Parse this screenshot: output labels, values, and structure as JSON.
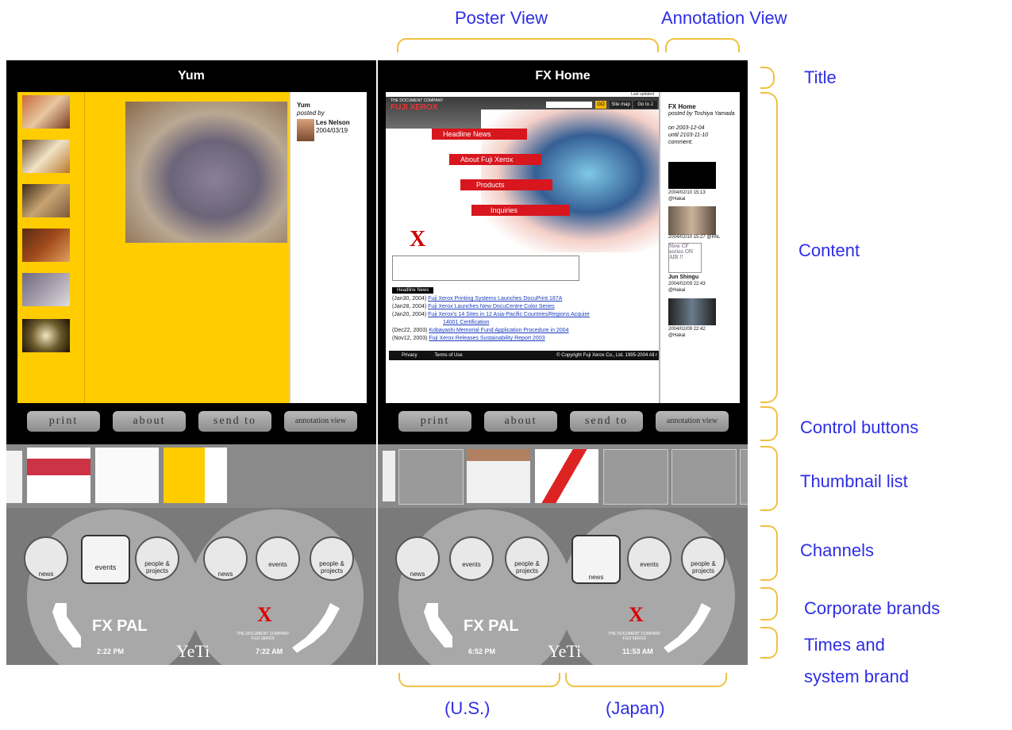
{
  "labels": {
    "poster_view": "Poster View",
    "annotation_view": "Annotation View",
    "title": "Title",
    "content": "Content",
    "control_buttons": "Control buttons",
    "thumbnail_list": "Thumbnail list",
    "channels": "Channels",
    "corporate_brands": "Corporate brands",
    "times_brand_1": "Times and",
    "times_brand_2": "system brand",
    "us": "(U.S.)",
    "japan": "(Japan)"
  },
  "left_screen": {
    "title": "Yum",
    "annotation": {
      "title": "Yum",
      "posted_by": "posted by",
      "author": "Les Nelson",
      "date": "2004/03/19"
    },
    "buttons": {
      "print": "print",
      "about": "about",
      "send_to": "send to",
      "annotation_view": "annotation view"
    },
    "channels": {
      "news": "news",
      "events": "events",
      "people": "people &\nprojects"
    },
    "brand_us": "FX PAL",
    "brand_jp": "THE DOCUMENT COMPANY\nFUJI XEROX",
    "time_us": "2:22 PM",
    "time_jp": "7:22 AM",
    "system_brand": "YeTi"
  },
  "right_screen": {
    "title": "FX Home",
    "last_updated": "Last updated",
    "site_brand": "THE DOCUMENT COMPANY",
    "site_name": "FUJI XEROX",
    "site_nav": [
      "Headline News",
      "About Fuji Xerox",
      "Products",
      "Inquiries"
    ],
    "search_go": "GO",
    "site_map": "Site map",
    "go_to": "Go to J",
    "headline_label": "Headline News",
    "news": [
      {
        "date": "(Jan30, 2004)",
        "text": "Fuji Xerox Printing Systems Launches DocuPrint 187A"
      },
      {
        "date": "(Jan28, 2004)",
        "text": "Fuji Xerox Launches New DocuCentre Color Series"
      },
      {
        "date": "(Jan20, 2004)",
        "text": "Fuji Xerox's 14 Sites in 12 Asia-Pacific Countries/Regions Acquire"
      },
      {
        "date": "",
        "text": "14001 Certification"
      },
      {
        "date": "(Dec22, 2003)",
        "text": "Kobayashi Memorial Fund Application Procedure in 2004"
      },
      {
        "date": "(Nov12, 2003)",
        "text": "Fuji Xerox Releases Sustainability Report 2003"
      }
    ],
    "footer": {
      "privacy": "Privacy",
      "terms": "Terms of Use",
      "copyright": "© Copyright Fuji Xerox Co., Ltd. 1995-2004 All r"
    },
    "annotation": {
      "title": "FX Home",
      "posted_by": "posted by Toshiya Yamada",
      "on": "on 2003-12-04",
      "until": "until 2103-11-10",
      "comment": "comment:",
      "entries": [
        {
          "time": "2004/02/10 15:13",
          "user": "@Hakai"
        },
        {
          "time": "2004/02/10 15:27 @PAL",
          "user": ""
        },
        {
          "time": "Jun Shingu",
          "user": "2004/02/09 22:43"
        },
        {
          "time": "@Hakai",
          "user": ""
        },
        {
          "time": "2004/02/09 22:42",
          "user": "@Hakai"
        }
      ],
      "handwriting": "New CF series ON AIR !!"
    },
    "buttons": {
      "print": "print",
      "about": "about",
      "send_to": "send to",
      "annotation_view": "annotation view"
    },
    "channels": {
      "news": "news",
      "events": "events",
      "people": "people &\nprojects"
    },
    "brand_us": "FX PAL",
    "brand_jp": "THE DOCUMENT COMPANY\nFUJI XEROX",
    "time_us": "6:52 PM",
    "time_jp": "11:53 AM",
    "system_brand": "YeTi"
  },
  "colors": {
    "label_blue": "#2e2ee6",
    "bracket": "#f0c040",
    "poster_yellow": "#ffcc00"
  }
}
